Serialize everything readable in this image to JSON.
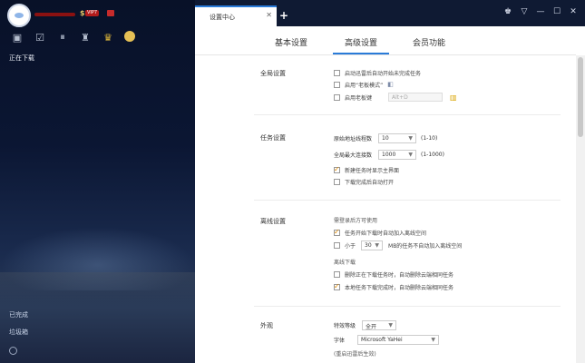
{
  "sidebar": {
    "vip_badge": "VIP7",
    "items": {
      "downloading": "正在下载",
      "completed": "已完成",
      "trash": "垃圾箱"
    }
  },
  "window": {
    "tab_title": "设置中心",
    "tab_close": "✕",
    "tab_add": "+"
  },
  "settings_tabs": {
    "basic": "基本设置",
    "advanced": "高级设置",
    "member": "会员功能"
  },
  "global": {
    "title": "全局设置",
    "auto_start_unfinished": "启动迅雷后自动开始未完成任务",
    "enable_boss_mode": "启用“老板模式”",
    "enable_hotkey": "启用老板键",
    "hotkey_value": "Alt+D"
  },
  "task": {
    "title": "任务设置",
    "orig_threads_label": "原始地址线程数",
    "orig_threads_value": "10",
    "orig_threads_range": "(1-10)",
    "max_conn_label": "全局最大连接数",
    "max_conn_value": "1000",
    "max_conn_range": "(1-1000)",
    "show_main_on_new": "新建任务时显示主界面",
    "auto_open_after": "下载完成后自动打开"
  },
  "offline": {
    "title": "离线设置",
    "note": "需登录后方可使用",
    "auto_add_offline_space": "任务开始下载时自动加入离线空间",
    "less_than_prefix": "小于",
    "less_than_value": "30",
    "less_than_suffix": "MB的任务不自动加入离线空间",
    "offline_download_label": "离线下载",
    "delete_cloud_on_delete": "删除正在下载任务时，自动删除云端相同任务",
    "delete_cloud_on_complete": "本地任务下载完成时，自动删除云端相同任务"
  },
  "appearance": {
    "title": "外观",
    "effect_label": "特效等级",
    "effect_value": "全开",
    "font_label": "字体",
    "font_value": "Microsoft YaHei",
    "restart_note": "(重启迅雷后生效)"
  }
}
